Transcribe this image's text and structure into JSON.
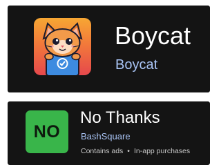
{
  "apps": [
    {
      "title": "Boycat",
      "developer": "Boycat",
      "icon": "cat-mascot-icon"
    },
    {
      "title": "No Thanks",
      "developer": "BashSquare",
      "icon_text": "NO",
      "meta": {
        "ads": "Contains ads",
        "separator": "•",
        "purchases": "In-app purchases"
      }
    }
  ],
  "colors": {
    "card_background": "#141414",
    "developer_link": "#a9c4f5",
    "no_icon_green": "#39b54a"
  }
}
